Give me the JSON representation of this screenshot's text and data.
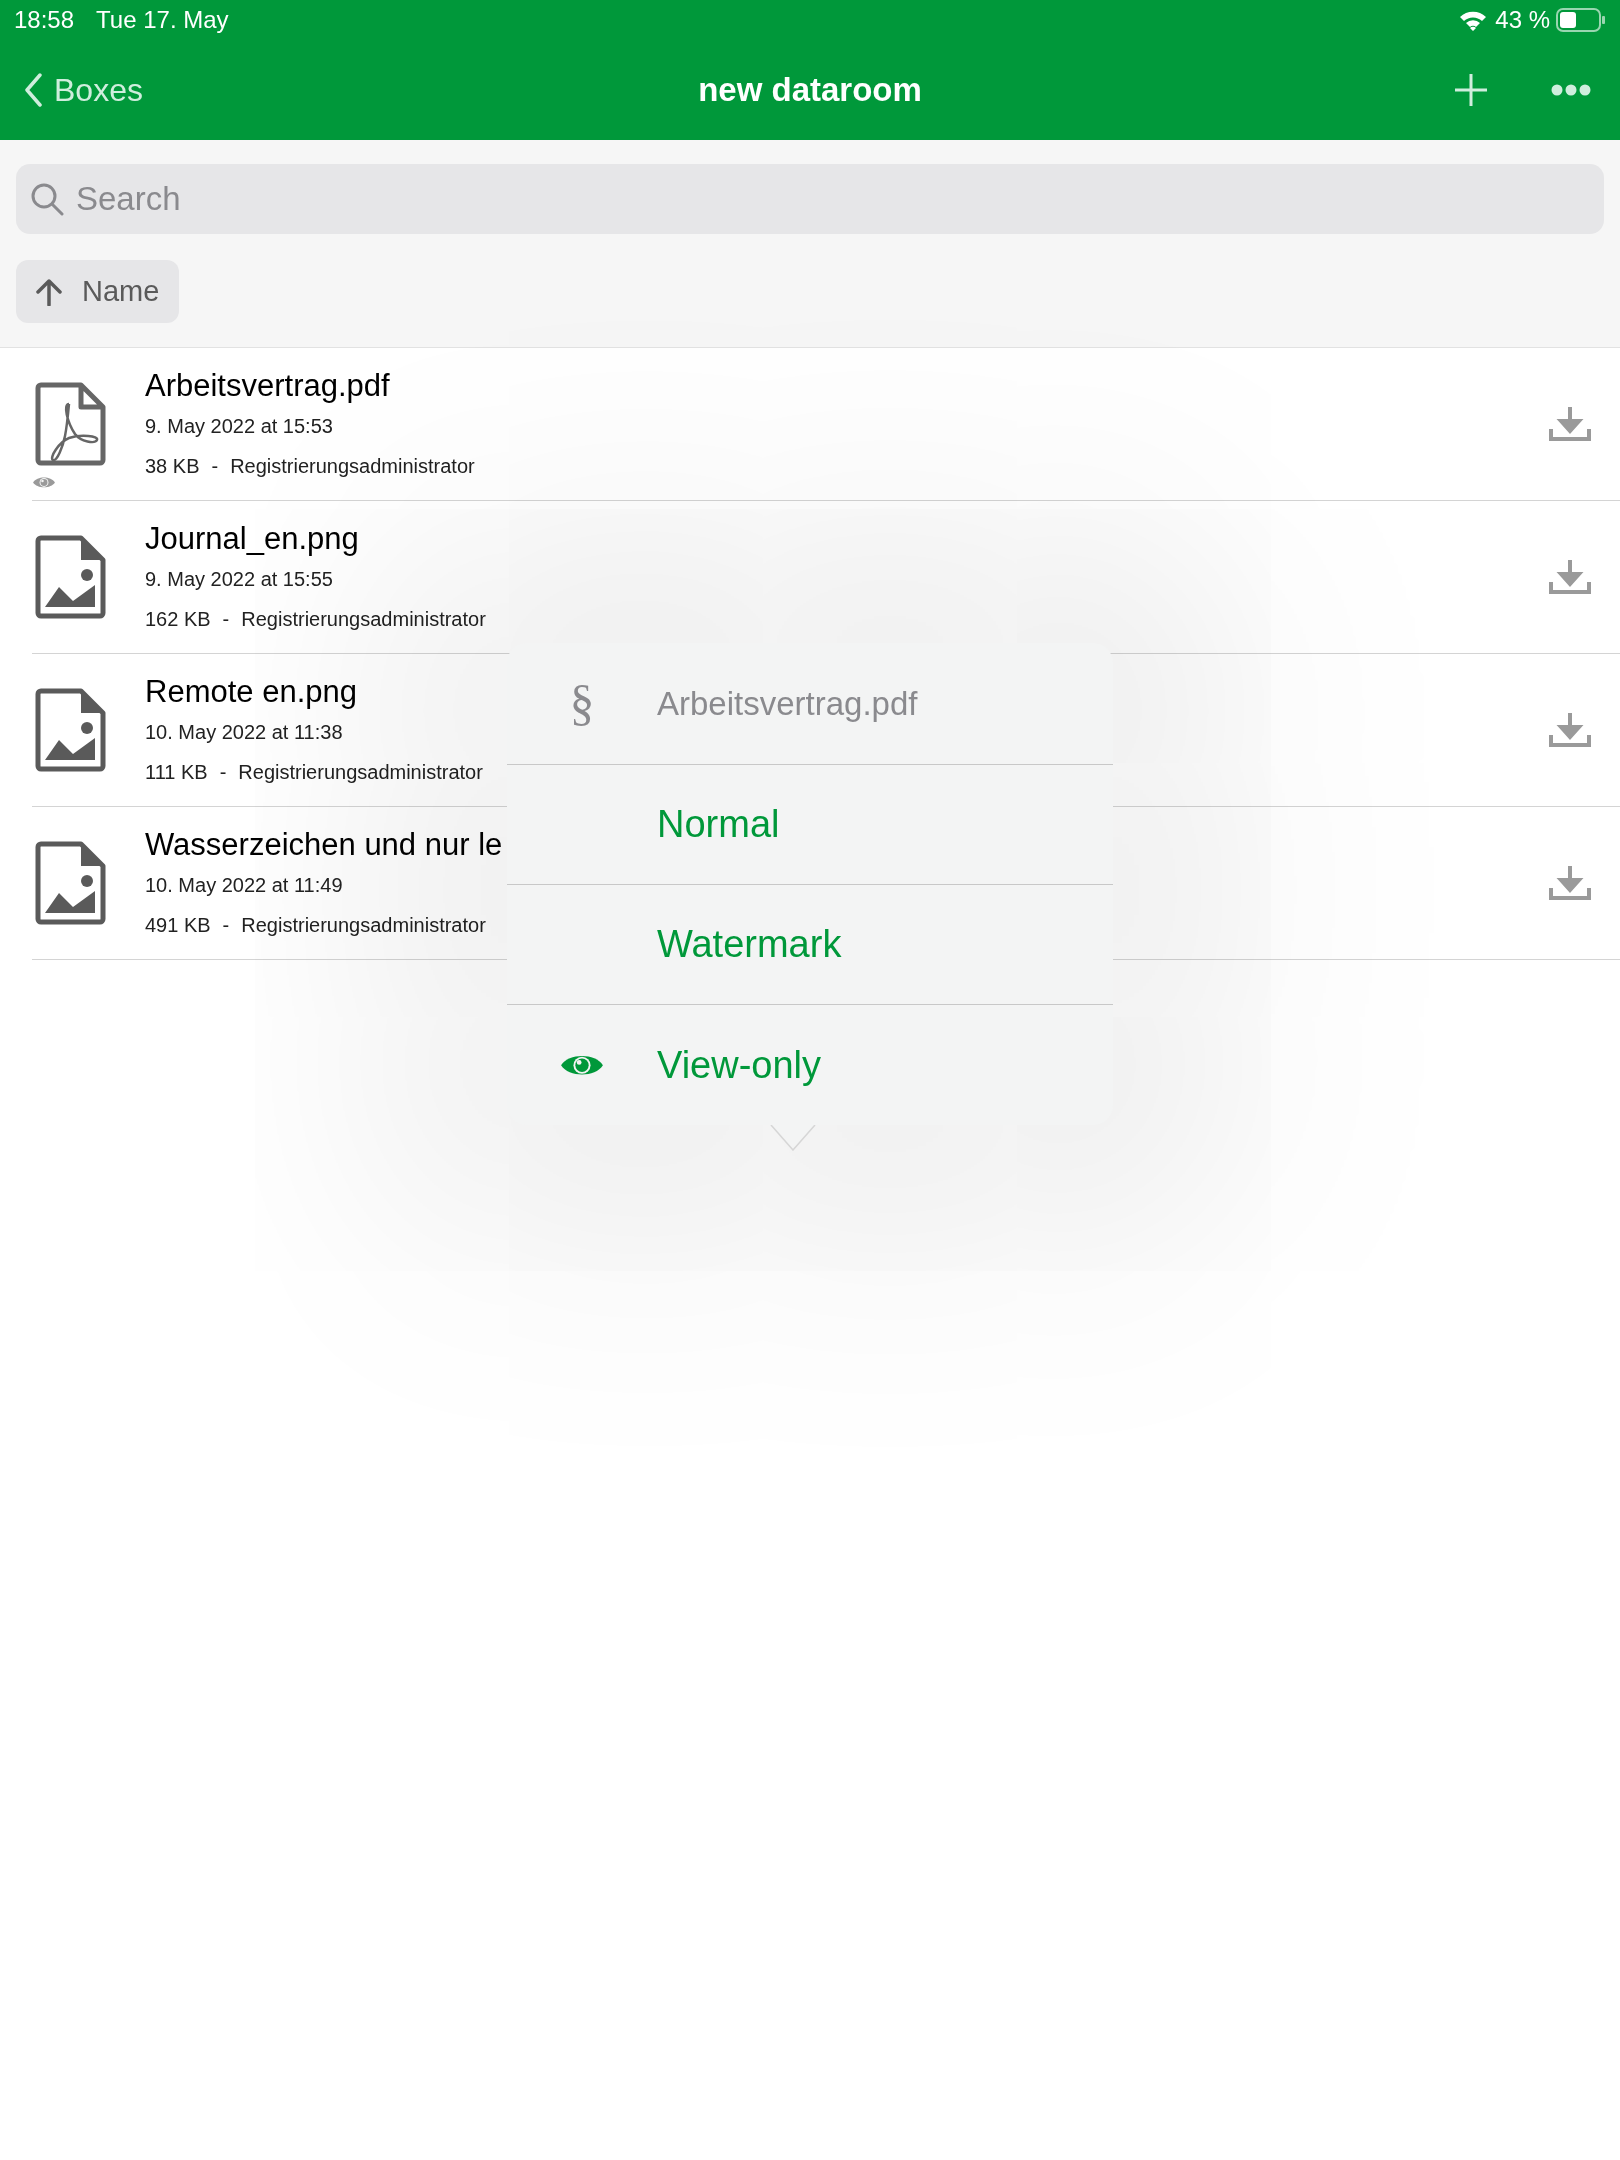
{
  "status_bar": {
    "time": "18:58",
    "date": "Tue 17. May",
    "battery": "43 %"
  },
  "nav_bar": {
    "back": "Boxes",
    "title": "new dataroom"
  },
  "search": {
    "placeholder": "Search"
  },
  "sort": {
    "label": "Name"
  },
  "files": [
    {
      "name": "Arbeitsvertrag.pdf",
      "kind": "pdf",
      "date": "9. May 2022 at 15:53",
      "size": "38 KB",
      "separator": "-",
      "owner": "Registrierungsadministrator",
      "view_only": true
    },
    {
      "name": "Journal_en.png",
      "kind": "image",
      "date": "9. May 2022 at 15:55",
      "size": "162 KB",
      "separator": "-",
      "owner": "Registrierungsadministrator",
      "view_only": false
    },
    {
      "name": "Remote en.png",
      "kind": "image",
      "date": "10. May 2022 at 11:38",
      "size": "111 KB",
      "separator": "-",
      "owner": "Registrierungsadministrator",
      "view_only": false
    },
    {
      "name": "Wasserzeichen und nur le",
      "kind": "image",
      "date": "10. May 2022 at 11:49",
      "size": "491 KB",
      "separator": "-",
      "owner": "Registrierungsadministrator",
      "view_only": false
    }
  ],
  "popover": {
    "header": {
      "glyph": "§",
      "title": "Arbeitsvertrag.pdf"
    },
    "options": [
      {
        "label": "Normal",
        "selected": false
      },
      {
        "label": "Watermark",
        "selected": false
      },
      {
        "label": "View-only",
        "selected": true
      }
    ]
  }
}
